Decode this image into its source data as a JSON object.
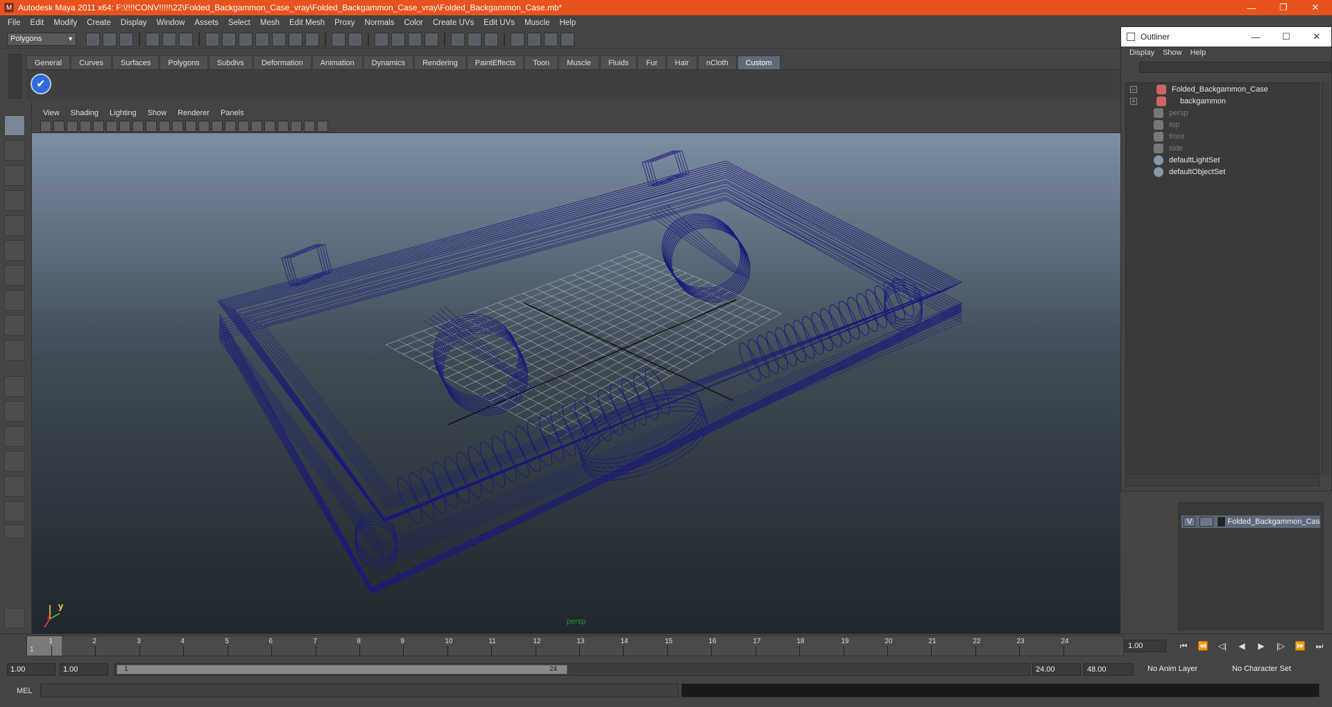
{
  "window": {
    "title": "Autodesk Maya 2011 x64: F:\\!!!!CONV!!!!!\\22\\Folded_Backgammon_Case_vray\\Folded_Backgammon_Case_vray\\Folded_Backgammon_Case.mb*",
    "minimize": "—",
    "restore": "❐",
    "close": "✕"
  },
  "menubar": [
    "File",
    "Edit",
    "Modify",
    "Create",
    "Display",
    "Window",
    "Assets",
    "Select",
    "Mesh",
    "Edit Mesh",
    "Proxy",
    "Normals",
    "Color",
    "Create UVs",
    "Edit UVs",
    "Muscle",
    "Help"
  ],
  "toolbar": {
    "mode": "Polygons"
  },
  "shelf": {
    "tabs": [
      "General",
      "Curves",
      "Surfaces",
      "Polygons",
      "Subdivs",
      "Deformation",
      "Animation",
      "Dynamics",
      "Rendering",
      "PaintEffects",
      "Toon",
      "Muscle",
      "Fluids",
      "Fur",
      "Hair",
      "nCloth",
      "Custom"
    ],
    "active": "Custom"
  },
  "viewport": {
    "menu": [
      "View",
      "Shading",
      "Lighting",
      "Show",
      "Renderer",
      "Panels"
    ],
    "camera": "persp",
    "axis_y": "y",
    "axis_x": "x",
    "wire_color": "#1a1a7a"
  },
  "outliner": {
    "title": "Outliner",
    "menu": [
      "Display",
      "Show",
      "Help"
    ],
    "items": [
      {
        "label": "Folded_Backgammon_Case",
        "expand": "−"
      },
      {
        "label": "backgammon",
        "expand": "+"
      },
      {
        "label": "persp"
      },
      {
        "label": "top"
      },
      {
        "label": "front"
      },
      {
        "label": "side"
      },
      {
        "label": "defaultLightSet"
      },
      {
        "label": "defaultObjectSet"
      }
    ]
  },
  "layers": {
    "row": {
      "v": "V",
      "name": "Folded_Backgammon_Case"
    }
  },
  "timeline": {
    "ticks": [
      "1",
      "2",
      "3",
      "4",
      "5",
      "6",
      "7",
      "8",
      "9",
      "10",
      "11",
      "12",
      "13",
      "14",
      "15",
      "16",
      "17",
      "18",
      "19",
      "20",
      "21",
      "22",
      "23",
      "24"
    ],
    "current": "1",
    "current_field": "1.00",
    "play": [
      "⏮",
      "⏪",
      "◁|",
      "◀",
      "▶",
      "|▷",
      "⏩",
      "⏭"
    ]
  },
  "range": {
    "start": "1.00",
    "start2": "1.00",
    "thumb_start": "1",
    "thumb_end": "24",
    "end": "24.00",
    "end2": "48.00",
    "anim_layer": "No Anim Layer",
    "char_set": "No Character Set"
  },
  "cmd": {
    "label": "MEL"
  }
}
